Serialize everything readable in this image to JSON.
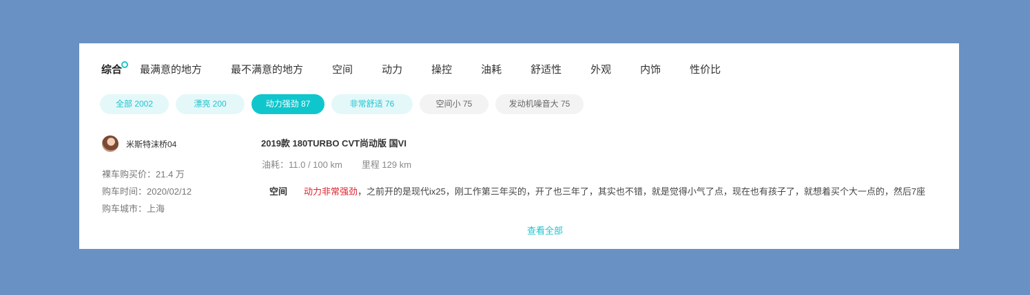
{
  "tabs": [
    {
      "label": "综合",
      "active": true
    },
    {
      "label": "最满意的地方"
    },
    {
      "label": "最不满意的地方"
    },
    {
      "label": "空间"
    },
    {
      "label": "动力"
    },
    {
      "label": "操控"
    },
    {
      "label": "油耗"
    },
    {
      "label": "舒适性"
    },
    {
      "label": "外观"
    },
    {
      "label": "内饰"
    },
    {
      "label": "性价比"
    }
  ],
  "tags": [
    {
      "label": "全部 2002",
      "kind": "positive"
    },
    {
      "label": "漂亮 200",
      "kind": "positive"
    },
    {
      "label": "动力强劲 87",
      "kind": "selected"
    },
    {
      "label": "非常舒适 76",
      "kind": "positive"
    },
    {
      "label": "空间小 75",
      "kind": "negative"
    },
    {
      "label": "发动机噪音大 75",
      "kind": "negative"
    }
  ],
  "user": {
    "name": "米斯特沫桥04",
    "price": "裸车购买价：21.4 万",
    "date": "购车时间：2020/02/12",
    "city": "购车城市：上海"
  },
  "review": {
    "model": "2019款 180TURBO CVT尚动版 国VI",
    "fuel": "油耗：11.0 / 100 km",
    "mileage": "里程 129 km",
    "section_label": "空间",
    "highlight": "动力非常强劲",
    "text": "，之前开的是现代ix25，刚工作第三年买的，开了也三年了，其实也不错，就是觉得小气了点，现在也有孩子了，就想着买个大一点的，然后7座",
    "more_label": "查看全部"
  },
  "colors": {
    "background": "#6991c3",
    "accent": "#1cc4cc",
    "highlight": "#e0202d"
  }
}
